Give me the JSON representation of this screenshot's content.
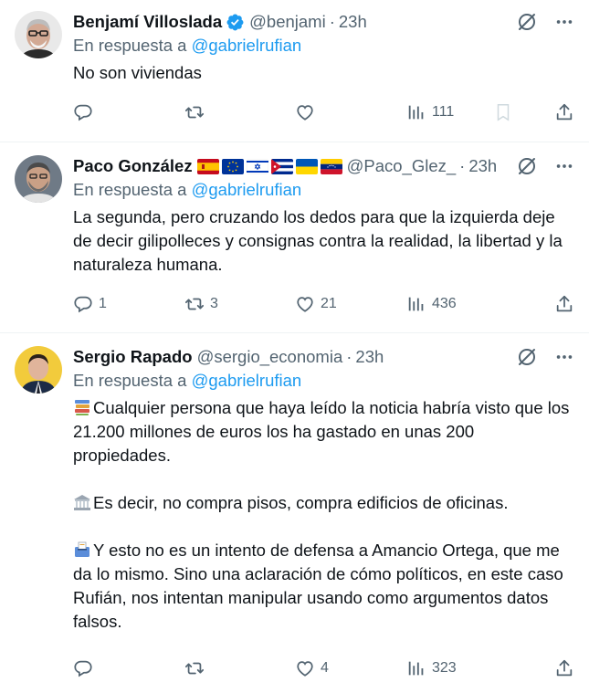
{
  "tweets": [
    {
      "name": "Benjamí Villoslada",
      "verified": true,
      "handle": "@benjami",
      "sep": "·",
      "time": "23h",
      "reply_prefix": "En respuesta a",
      "reply_to": "@gabrielrufian",
      "paragraphs": [
        "No son viviendas"
      ],
      "counts": {
        "replies": "",
        "retweets": "",
        "likes": "",
        "views": "111"
      }
    },
    {
      "name": "Paco González",
      "flags": [
        "spain-flag",
        "eu-flag",
        "israel-flag",
        "cuba-flag",
        "ukraine-flag",
        "venezuela-flag"
      ],
      "handle": "@Paco_Glez_",
      "sep": "·",
      "time": "23h",
      "reply_prefix": "En respuesta a",
      "reply_to": "@gabrielrufian",
      "paragraphs": [
        "La segunda, pero cruzando los dedos para que la izquierda deje de decir gilipolleces y consignas contra la realidad, la libertad y la naturaleza humana."
      ],
      "counts": {
        "replies": "1",
        "retweets": "3",
        "likes": "21",
        "views": "436"
      }
    },
    {
      "name": "Sergio Rapado",
      "handle": "@sergio_economia",
      "sep": "·",
      "time": "23h",
      "reply_prefix": "En respuesta a",
      "reply_to": "@gabrielrufian",
      "paragraphs": [
        "Cualquier persona que haya leído la noticia habría visto que los 21.200 millones de euros los ha gastado en unas 200 propiedades.",
        "Es decir, no compra pisos, compra edificios de oficinas.",
        "Y esto no es un intento de defensa a Amancio Ortega, que me da lo mismo. Sino una aclaración de cómo políticos, en este caso Rufián, nos intentan manipular usando como argumentos datos falsos."
      ],
      "paragraph_emojis": [
        "books-emoji",
        "classical-building-emoji",
        "ballot-box-emoji"
      ],
      "counts": {
        "replies": "",
        "retweets": "",
        "likes": "4",
        "views": "323"
      }
    }
  ],
  "colors": {
    "text": "#0f1419",
    "secondary": "#536471",
    "link": "#1d9bf0",
    "divider": "#eff3f4",
    "verified": "#1d9bf0"
  }
}
